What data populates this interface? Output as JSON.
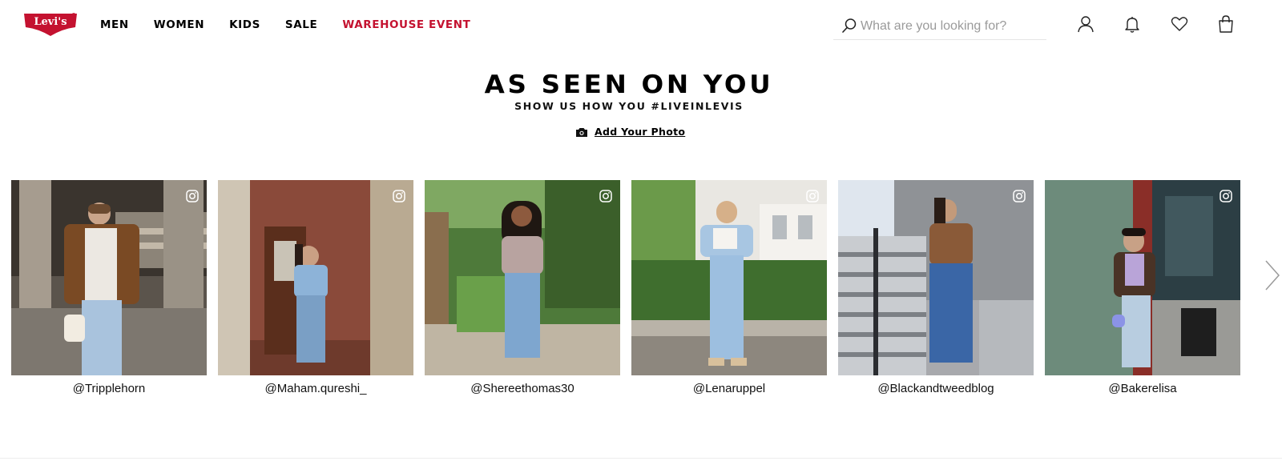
{
  "brand": {
    "logo_text": "Levi's",
    "accent_color": "#c41230"
  },
  "nav": {
    "items": [
      {
        "label": "MEN"
      },
      {
        "label": "WOMEN"
      },
      {
        "label": "KIDS"
      },
      {
        "label": "SALE"
      },
      {
        "label": "WAREHOUSE EVENT",
        "color": "#c41230"
      }
    ]
  },
  "search": {
    "placeholder": "What are you looking for?",
    "value": "",
    "icon": "search-icon"
  },
  "header_icons": [
    "account-icon",
    "bell-icon",
    "heart-icon",
    "bag-icon"
  ],
  "section": {
    "title": "AS SEEN ON YOU",
    "subtitle": "SHOW US HOW YOU #LIVEINLEVIS",
    "add_photo_label": "Add Your Photo",
    "add_photo_icon": "camera-icon"
  },
  "gallery": {
    "items": [
      {
        "handle": "@Tripplehorn",
        "icon": "instagram-icon"
      },
      {
        "handle": "@Maham.qureshi_",
        "icon": "instagram-icon"
      },
      {
        "handle": "@Shereethomas30",
        "icon": "instagram-icon"
      },
      {
        "handle": "@Lenaruppel",
        "icon": "instagram-icon"
      },
      {
        "handle": "@Blackandtweedblog",
        "icon": "instagram-icon"
      },
      {
        "handle": "@Bakerelisa",
        "icon": "instagram-icon"
      }
    ],
    "next_icon": "chevron-right-icon"
  }
}
